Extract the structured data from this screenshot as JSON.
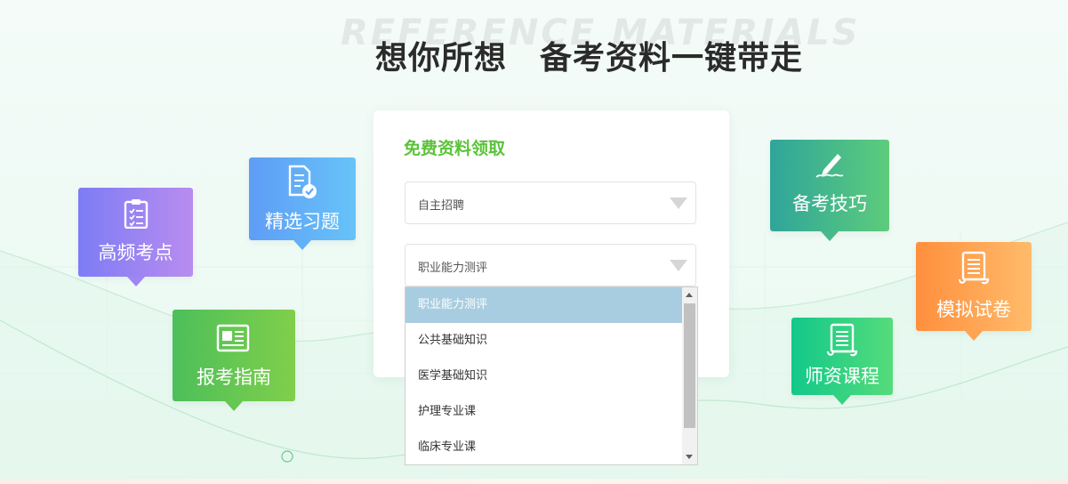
{
  "watermark": "REFERENCE MATERIALS",
  "headline": "想你所想　备考资料一键带走",
  "form": {
    "title": "免费资料领取",
    "select_category": "自主招聘",
    "select_subject": "职业能力测评"
  },
  "dropdown": {
    "options": [
      "职业能力测评",
      "公共基础知识",
      "医学基础知识",
      "护理专业课",
      "临床专业课"
    ],
    "selected_index": 0
  },
  "tags": {
    "gaopin": "高频考点",
    "jingxuan": "精选习题",
    "baokao": "报考指南",
    "beikao": "备考技巧",
    "moni": "模拟试卷",
    "shizi": "师资课程"
  },
  "colors": {
    "accent_green": "#5cc23a",
    "selected_option": "#a9cde0",
    "headline": "#2b2b2b"
  },
  "icons": {
    "gaopin": "clipboard-checklist-icon",
    "jingxuan": "document-check-icon",
    "baokao": "newspaper-icon",
    "beikao": "pen-signature-icon",
    "moni": "scroll-icon",
    "shizi": "scroll-icon"
  }
}
